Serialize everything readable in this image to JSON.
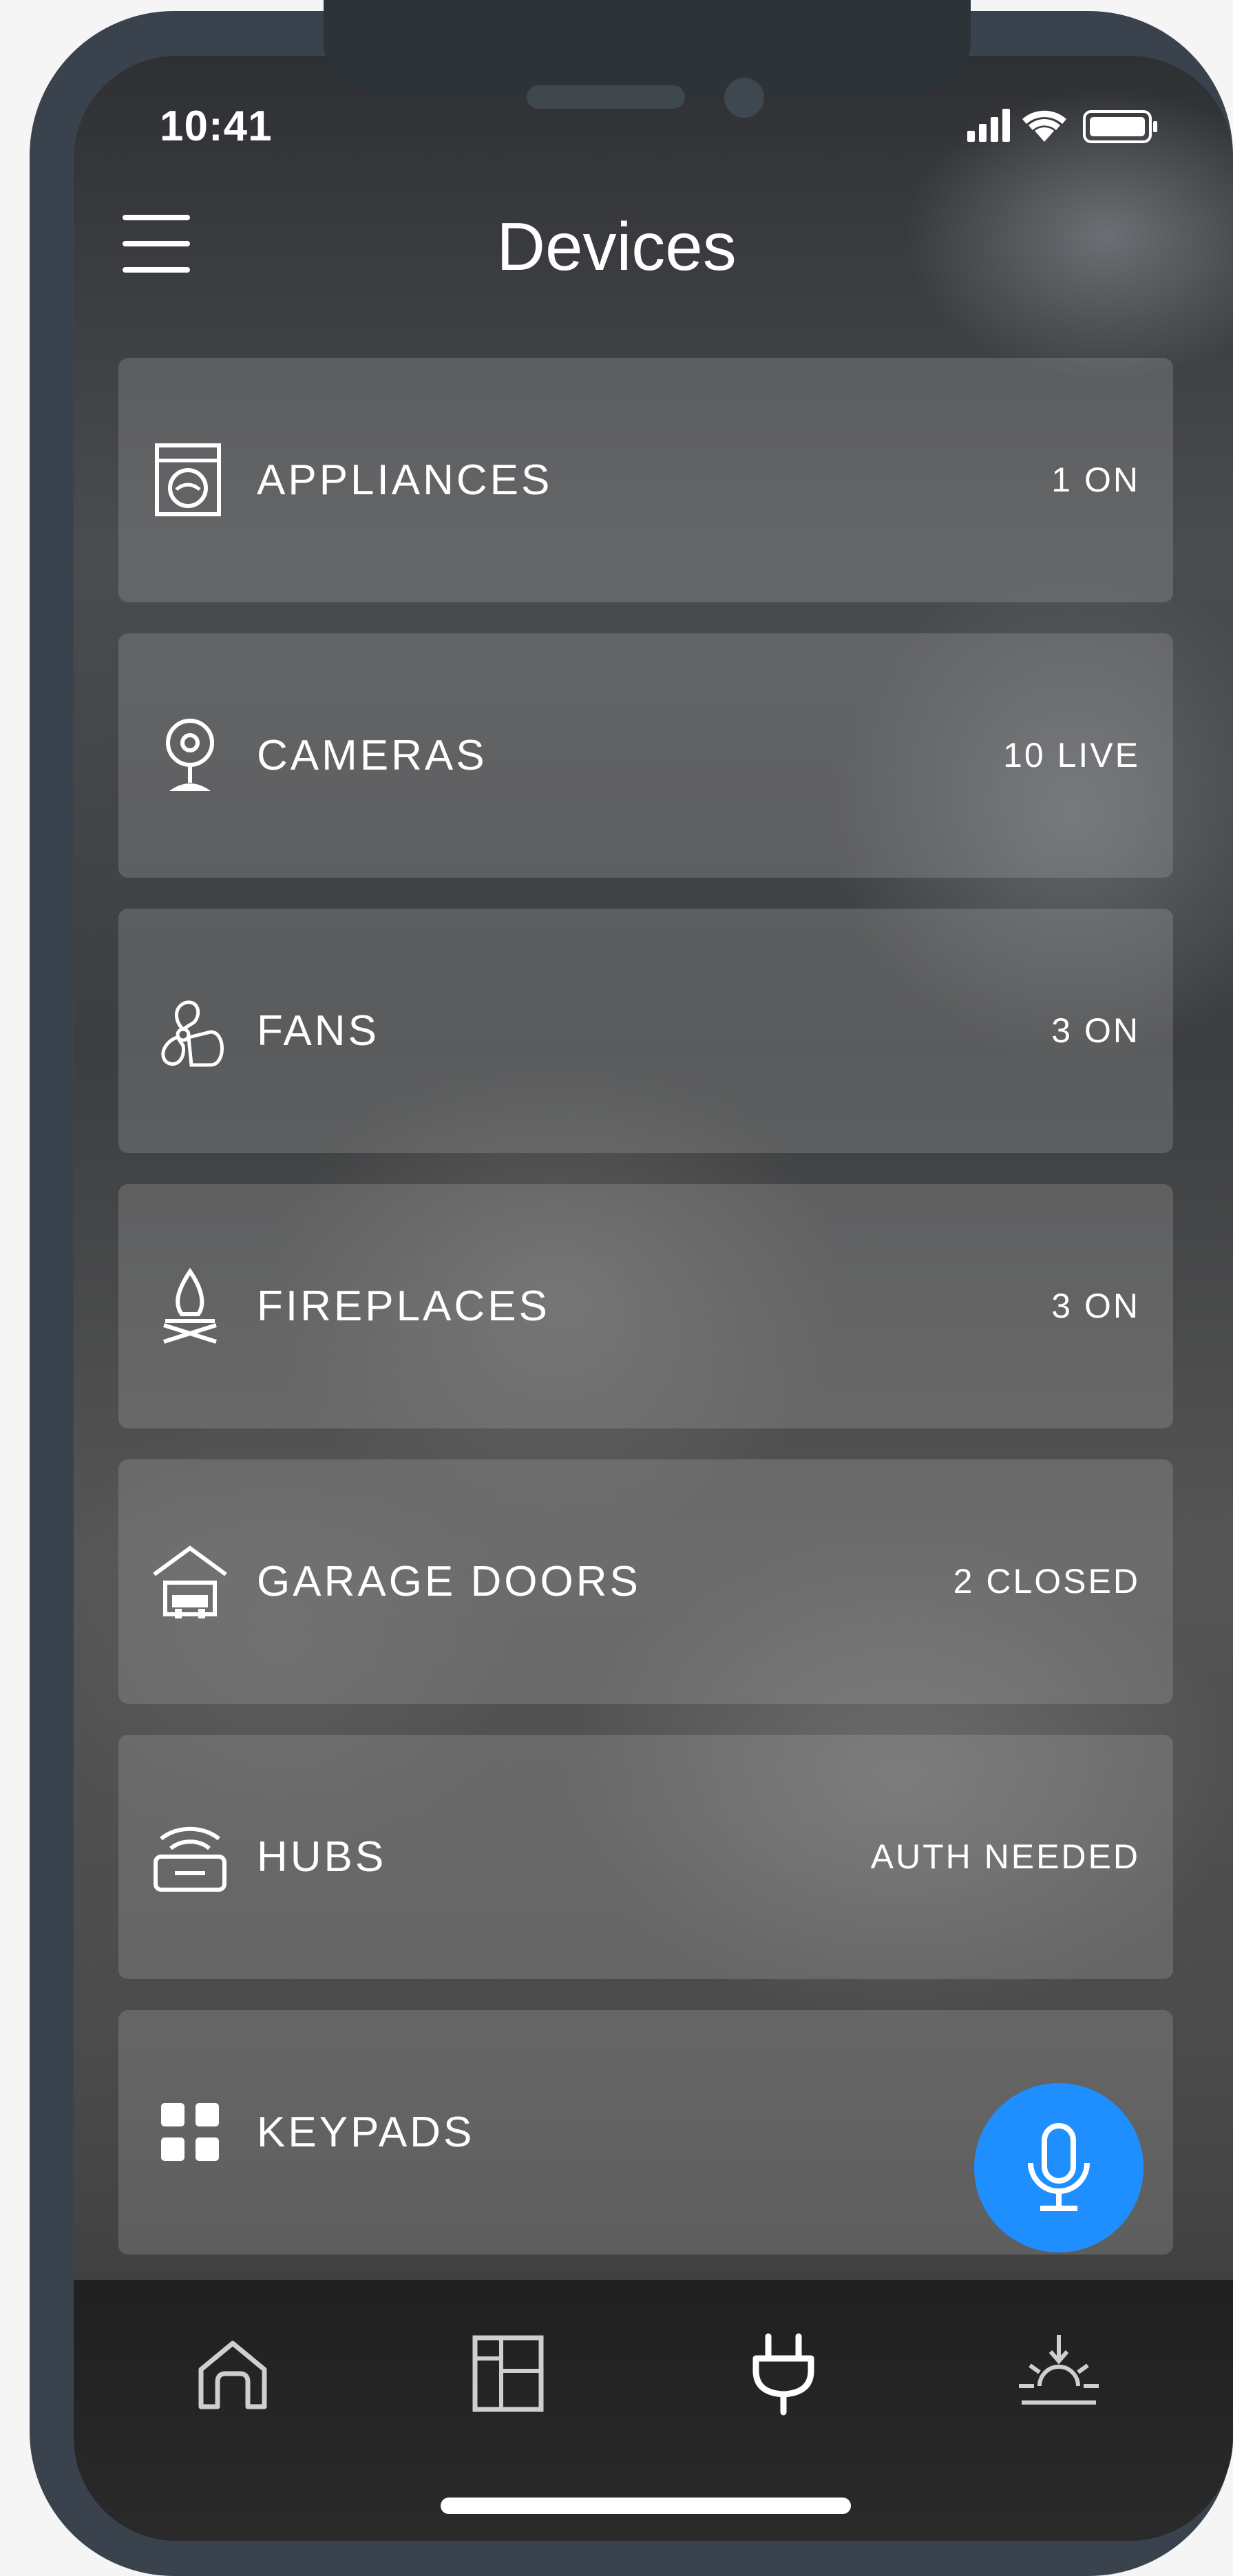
{
  "status_bar": {
    "time": "10:41",
    "icons": [
      "cellular-signal-icon",
      "wifi-icon",
      "battery-icon"
    ]
  },
  "header": {
    "title": "Devices",
    "menu_icon": "hamburger-menu-icon"
  },
  "device_categories": [
    {
      "label": "APPLIANCES",
      "status": "1 ON",
      "icon": "washing-machine-icon"
    },
    {
      "label": "CAMERAS",
      "status": "10 LIVE",
      "icon": "webcam-icon"
    },
    {
      "label": "FANS",
      "status": "3 ON",
      "icon": "fan-icon"
    },
    {
      "label": "FIREPLACES",
      "status": "3 ON",
      "icon": "fireplace-icon"
    },
    {
      "label": "GARAGE DOORS",
      "status": "2 CLOSED",
      "icon": "garage-icon"
    },
    {
      "label": "HUBS",
      "status": "AUTH NEEDED",
      "icon": "hub-icon"
    },
    {
      "label": "KEYPADS",
      "status": "",
      "icon": "keypad-icon"
    }
  ],
  "voice_button": {
    "icon": "microphone-icon",
    "color": "#1f8fff"
  },
  "bottom_nav": [
    {
      "name": "home",
      "icon": "home-icon",
      "active": false
    },
    {
      "name": "rooms",
      "icon": "floorplan-icon",
      "active": false
    },
    {
      "name": "devices",
      "icon": "plug-icon",
      "active": true
    },
    {
      "name": "scenes",
      "icon": "sunrise-icon",
      "active": false
    }
  ]
}
